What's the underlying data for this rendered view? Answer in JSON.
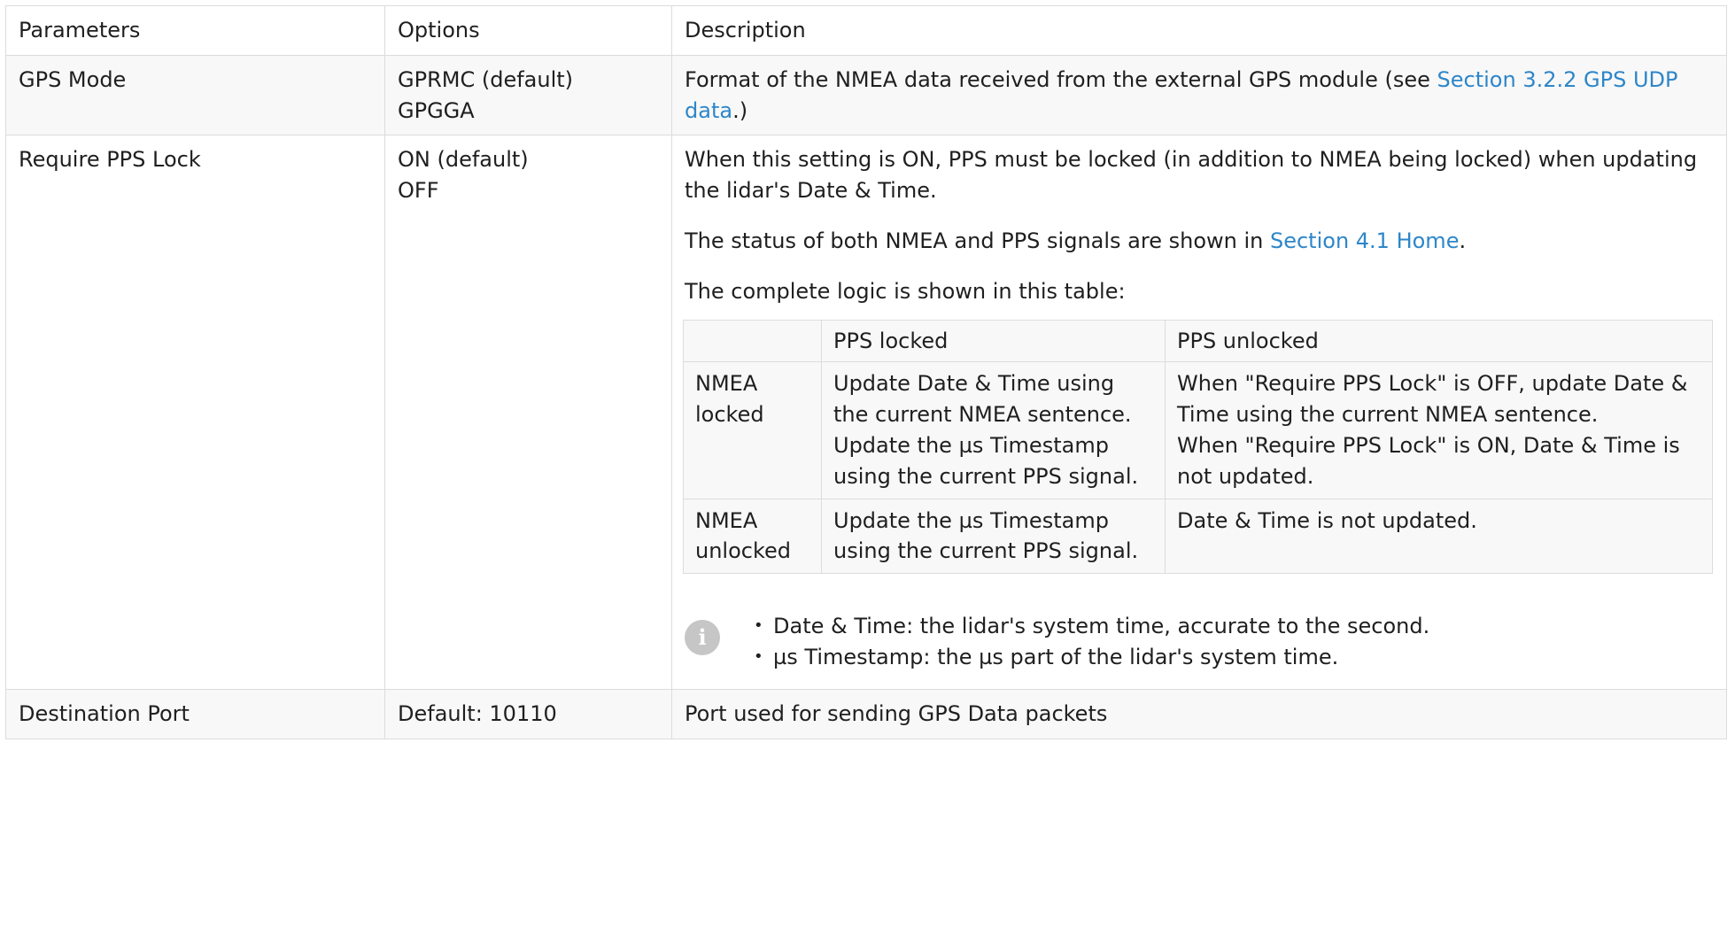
{
  "headers": {
    "parameters": "Parameters",
    "options": "Options",
    "description": "Description"
  },
  "rows": {
    "gps_mode": {
      "parameter": "GPS Mode",
      "options": [
        "GPRMC (default)",
        "GPGGA"
      ],
      "desc_before": "Format of the NMEA data received from the external GPS module (see ",
      "desc_link": "Section 3.2.2 GPS UDP data",
      "desc_after": ".)"
    },
    "require_pps": {
      "parameter": "Require PPS Lock",
      "options": [
        "ON (default)",
        "OFF"
      ],
      "para1": "When this setting is ON, PPS must be locked (in addition to NMEA being locked) when updating the lidar's Date & Time.",
      "para2_before": "The status of both NMEA and PPS signals are shown in ",
      "para2_link": "Section 4.1 Home",
      "para2_after": ".",
      "para3": "The complete logic is shown in this table:",
      "logic_table": {
        "headers": [
          "",
          "PPS locked",
          "PPS unlocked"
        ],
        "rows": [
          {
            "label": "NMEA locked",
            "pps_locked": [
              "Update Date & Time using the current NMEA sentence.",
              "Update the µs Timestamp using the current PPS signal."
            ],
            "pps_unlocked": [
              "When \"Require PPS Lock\" is OFF, update Date & Time using the current NMEA sentence.",
              "When \"Require PPS Lock\" is ON, Date & Time is not updated."
            ]
          },
          {
            "label": "NMEA unlocked",
            "pps_locked": [
              "Update the µs Timestamp using the current PPS signal."
            ],
            "pps_unlocked": [
              "Date & Time is not updated."
            ]
          }
        ]
      },
      "note": {
        "icon": "info-icon",
        "items": [
          "Date & Time: the lidar's system time, accurate to the second.",
          "µs Timestamp: the µs part of the lidar's system time."
        ]
      }
    },
    "destination_port": {
      "parameter": "Destination Port",
      "options": [
        "Default: 10110"
      ],
      "description": "Port used for sending GPS Data packets"
    }
  },
  "colors": {
    "link": "#2e86c9",
    "border": "#dcdcdc",
    "row_alt": "#f8f8f8",
    "icon": "#c6c6c6"
  }
}
